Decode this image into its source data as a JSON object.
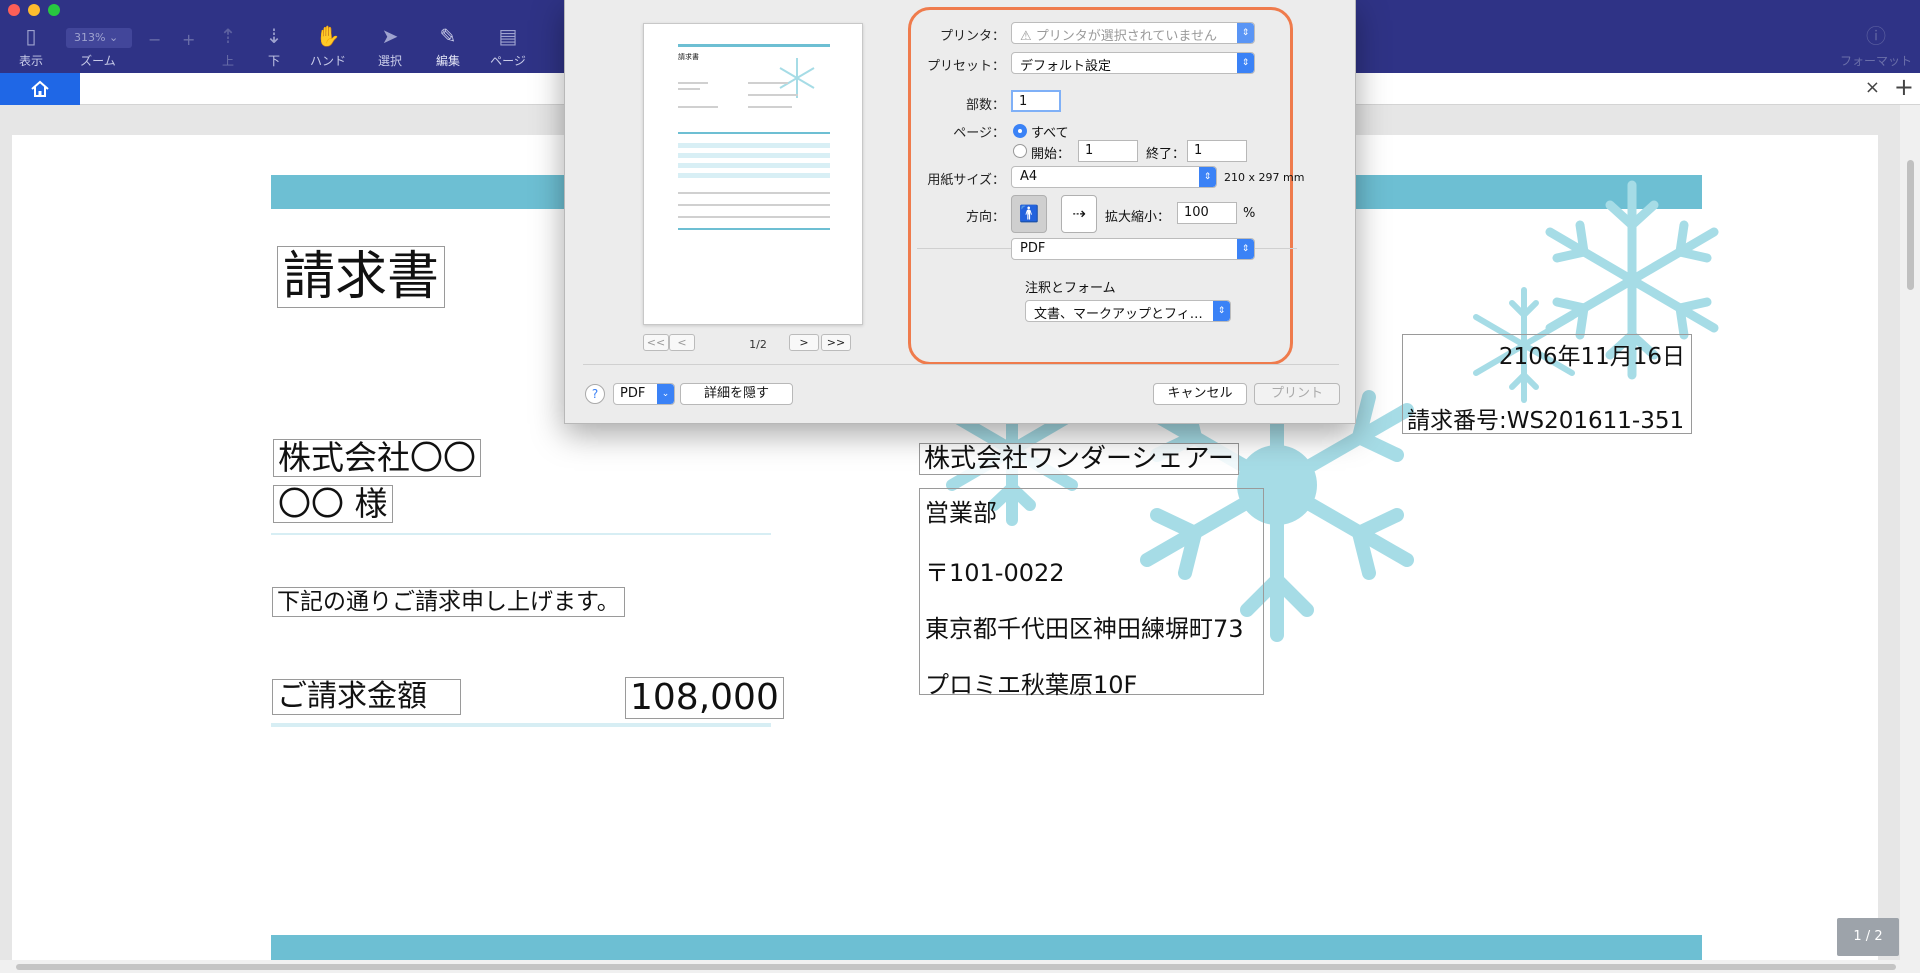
{
  "toolbar": {
    "items": [
      {
        "label": "表示",
        "icon": "sidebar-icon"
      },
      {
        "label": "ズーム",
        "icon": "zoom-icon"
      },
      {
        "label": "上",
        "icon": "page-up-icon"
      },
      {
        "label": "下",
        "icon": "page-down-icon"
      },
      {
        "label": "ハンド",
        "icon": "hand-icon"
      },
      {
        "label": "選択",
        "icon": "select-cursor-icon"
      },
      {
        "label": "編集",
        "icon": "edit-icon"
      },
      {
        "label": "ページ",
        "icon": "page-icon"
      },
      {
        "label": "フォーマット",
        "icon": "info-icon"
      }
    ],
    "zoom_value": "313%",
    "zoom_minus": "−",
    "zoom_plus": "+"
  },
  "tabbar": {
    "home_icon": "home-icon",
    "close_label": "×",
    "add_label": "+"
  },
  "document": {
    "title": "請求書",
    "client_company": "株式会社〇〇",
    "client_name": "〇〇 様",
    "intro_text": "下記の通りご請求申し上げます。",
    "amount_label": "ご請求金額",
    "amount_value": "108,000",
    "date": "2106年11月16日",
    "invoice_number": "請求番号:WS201611-351",
    "issuer_company": "株式会社ワンダーシェアー",
    "issuer_department": "営業部",
    "issuer_postal": "〒101-0022",
    "issuer_address": "東京都千代田区神田練塀町73",
    "issuer_building": "プロミエ秋葉原10F",
    "accent_color": "#6dbfd3"
  },
  "page_counter": "1 / 2",
  "print_dialog": {
    "preview": {
      "title": "請求書",
      "page_indicator": "1/2",
      "nav_first": "<<",
      "nav_prev": "<",
      "nav_next": ">",
      "nav_last": ">>"
    },
    "printer_label": "プリンタ：",
    "printer_value": "⚠ プリンタが選択されていません",
    "preset_label": "プリセット：",
    "preset_value": "デフォルト設定",
    "copies_label": "部数：",
    "copies_value": "1",
    "pages_label": "ページ：",
    "pages_all": "すべて",
    "pages_from_label": "開始：",
    "pages_from_value": "1",
    "pages_to_label": "終了：",
    "pages_to_value": "1",
    "paper_label": "用紙サイズ：",
    "paper_value": "A4",
    "paper_dims": "210 x 297 mm",
    "orientation_label": "方向：",
    "scale_label": "拡大縮小：",
    "scale_value": "100",
    "scale_unit": "%",
    "section_value": "PDF",
    "annotations_label": "注釈とフォーム",
    "annotations_value": "文書、マークアップとフィ…",
    "help_label": "?",
    "pdf_button": "PDF",
    "hide_details": "詳細を隠す",
    "cancel": "キャンセル",
    "print": "プリント",
    "highlight_color": "#ef7b4c"
  }
}
